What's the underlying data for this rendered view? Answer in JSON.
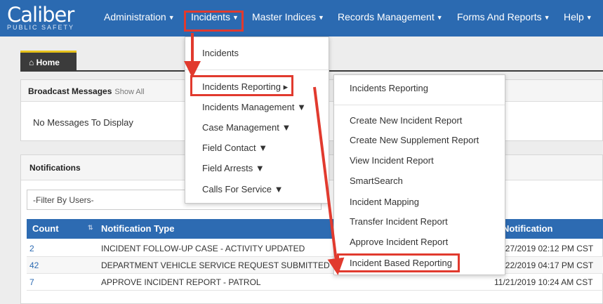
{
  "logo": {
    "main": "Caliber",
    "sub": "PUBLIC SAFETY"
  },
  "nav": {
    "administration": "Administration",
    "incidents": "Incidents",
    "master_indices": "Master Indices",
    "records_management": "Records Management",
    "forms_and_reports": "Forms And Reports",
    "help": "Help",
    "caret": "▼"
  },
  "home_tab": {
    "icon": "⌂",
    "label": "Home"
  },
  "broadcast": {
    "title": "Broadcast Messages",
    "show_all": "Show All",
    "empty": "No Messages To Display"
  },
  "notifications": {
    "title": "Notifications",
    "filter_selected": "-Filter By Users-",
    "columns": {
      "count": "Count",
      "type": "Notification Type",
      "date": "Notification"
    },
    "rows": [
      {
        "count": "2",
        "type": "INCIDENT FOLLOW-UP CASE - ACTIVITY UPDATED",
        "date": "11/27/2019 02:12 PM CST"
      },
      {
        "count": "42",
        "type": "DEPARTMENT VEHICLE SERVICE REQUEST SUBMITTED",
        "date": "11/22/2019 04:17 PM CST"
      },
      {
        "count": "7",
        "type": "APPROVE INCIDENT REPORT - PATROL",
        "date": "11/21/2019 10:24 AM CST"
      }
    ]
  },
  "incidents_menu": {
    "header": "Incidents",
    "items": [
      "Incidents Reporting ▸",
      "Incidents Management ▼",
      "Case Management ▼",
      "Field Contact ▼",
      "Field Arrests ▼",
      "Calls For Service ▼"
    ]
  },
  "reporting_menu": {
    "header": "Incidents Reporting",
    "items": [
      "Create New Incident Report",
      "Create New Supplement Report",
      "View Incident Report",
      "SmartSearch",
      "Incident Mapping",
      "Transfer Incident Report",
      "Approve Incident Report",
      "Incident Based Reporting"
    ]
  },
  "colors": {
    "nav_bg": "#2b6ab1",
    "highlight": "#e13a2e",
    "table_header": "#2d6bb2"
  }
}
